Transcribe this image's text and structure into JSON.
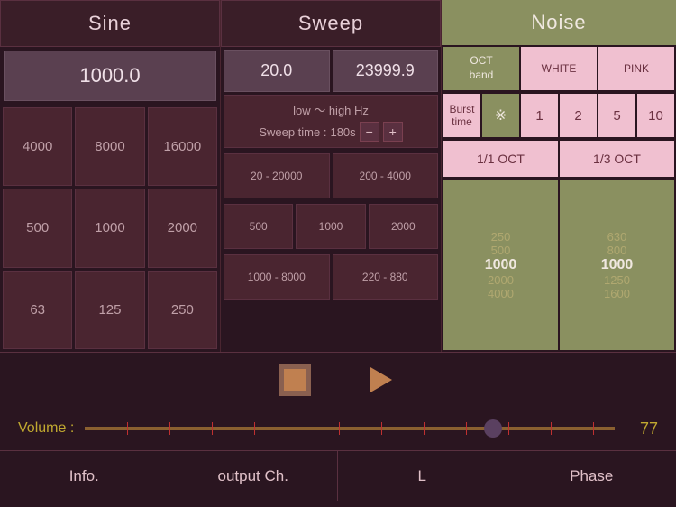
{
  "sine": {
    "label": "Sine",
    "freq_display": "1000.0",
    "grid": [
      [
        "4000",
        "8000",
        "16000"
      ],
      [
        "500",
        "1000",
        "2000"
      ],
      [
        "63",
        "125",
        "250"
      ]
    ]
  },
  "sweep": {
    "label": "Sweep",
    "freq_low": "20.0",
    "freq_high": "23999.9",
    "range_label": "low 〜 high Hz",
    "sweep_time_label": "Sweep time : ",
    "sweep_time_value": "180s",
    "grid_row1": [
      "20 - 20000",
      "200 - 4000"
    ],
    "grid_row2": [
      "1000 - 8000",
      "220 - 880"
    ]
  },
  "noise": {
    "label": "Noise",
    "oct_band_label": "OCT\nband",
    "white_label": "WHITE",
    "pink_label": "PINK",
    "burst_time_label": "Burst\ntime",
    "burst_symbol": "※",
    "burst_values": [
      "1",
      "2",
      "5",
      "10"
    ],
    "oct_1": "1/1 OCT",
    "oct_3": "1/3 OCT",
    "freq_list_1": [
      "250",
      "500",
      "1000",
      "2000",
      "4000"
    ],
    "freq_list_3": [
      "630",
      "800",
      "1000",
      "1250",
      "1600"
    ]
  },
  "transport": {
    "stop_label": "stop",
    "play_label": "play"
  },
  "volume": {
    "label": "Volume : ",
    "value": "77"
  },
  "nav": {
    "info": "Info.",
    "output_ch": "output Ch.",
    "channel": "L",
    "phase": "Phase"
  }
}
